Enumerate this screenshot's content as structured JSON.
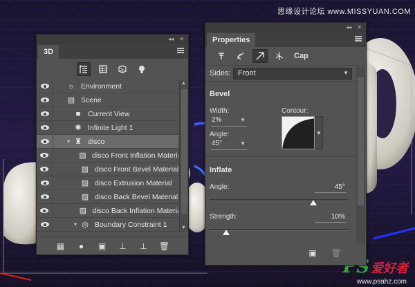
{
  "watermark": {
    "top_text": "思缘设计论坛 www.MISSYUAN.COM",
    "logo_ps": "PS",
    "logo_cn": "爱好者",
    "url": "www.psahz.com"
  },
  "panel_3d": {
    "tab": "3D",
    "collapse": "◂◂",
    "close": "✕",
    "toolbar_icons": [
      "scene-filter-icon",
      "mesh-filter-icon",
      "material-filter-icon",
      "light-filter-icon"
    ],
    "rows": [
      {
        "label": "Environment",
        "icon": "☼",
        "indent": 0,
        "chev": "",
        "selected": false
      },
      {
        "label": "Scene",
        "icon": "▤",
        "indent": 0,
        "chev": "",
        "selected": false
      },
      {
        "label": "Current View",
        "icon": "■",
        "indent": 1,
        "chev": "",
        "selected": false
      },
      {
        "label": "Infinite Light 1",
        "icon": "✺",
        "indent": 1,
        "chev": "",
        "selected": false
      },
      {
        "label": "disco",
        "icon": "♜",
        "indent": 1,
        "chev": "▾",
        "selected": true
      },
      {
        "label": "disco Front Inflation Material",
        "icon": "▨",
        "indent": 2,
        "chev": "",
        "selected": false
      },
      {
        "label": "disco Front Bevel Material",
        "icon": "▨",
        "indent": 2,
        "chev": "",
        "selected": false
      },
      {
        "label": "disco Extrusion Material",
        "icon": "▨",
        "indent": 2,
        "chev": "",
        "selected": false
      },
      {
        "label": "disco Back Bevel Material",
        "icon": "▨",
        "indent": 2,
        "chev": "",
        "selected": false
      },
      {
        "label": "disco Back Inflation Material",
        "icon": "▨",
        "indent": 2,
        "chev": "",
        "selected": false
      },
      {
        "label": "Boundary Constraint 1",
        "icon": "◎",
        "indent": 2,
        "chev": "▾",
        "selected": false
      }
    ]
  },
  "panel_props": {
    "tab": "Properties",
    "collapse": "◂◂",
    "close": "✕",
    "cap_label": "Cap",
    "sides_label": "Sides:",
    "sides_value": "Front",
    "bevel_title": "Bevel",
    "width_label": "Width:",
    "width_value": "2%",
    "contour_label": "Contour:",
    "angle_label": "Angle:",
    "angle_value": "45°",
    "inflate_title": "Inflate",
    "inflate_angle_label": "Angle:",
    "inflate_angle_value": "45°",
    "inflate_angle_fraction": 0.75,
    "strength_label": "Strength:",
    "strength_value": "10%",
    "strength_fraction": 0.12
  }
}
